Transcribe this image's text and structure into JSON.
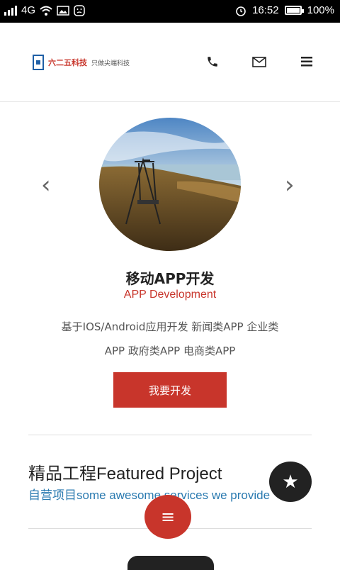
{
  "status_bar": {
    "network": "4G",
    "time": "16:52",
    "battery": "100%",
    "battery_level": 1.0
  },
  "header": {
    "logo_name": "六二五科技",
    "logo_slogan": "只做尖端科技",
    "icons": [
      "phone-icon",
      "mail-icon",
      "menu-icon"
    ]
  },
  "slider": {
    "title": "移动APP开发",
    "subtitle": "APP Development",
    "desc_line1": "基于IOS/Android应用开发 新闻类APP 企业类",
    "desc_line2": "APP 政府类APP 电商类APP",
    "cta_label": "我要开发",
    "prev_icon": "‹",
    "next_icon": "›"
  },
  "featured": {
    "title": "精品工程Featured Project",
    "subtitle": "自营项目some awesome services we provide"
  },
  "fab": {
    "star_icon": "★",
    "menu_icon": "≡"
  },
  "colors": {
    "accent_red": "#c8352b",
    "link_blue": "#2a7ab0",
    "dark": "#222222"
  }
}
